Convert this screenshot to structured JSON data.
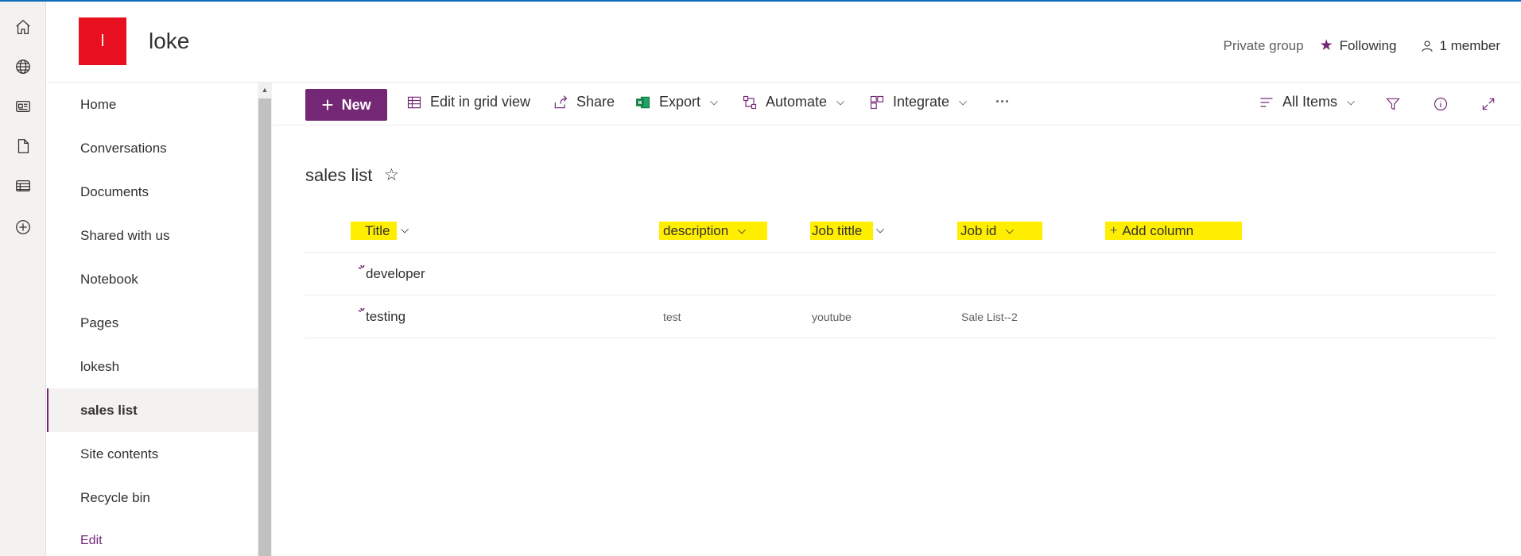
{
  "rail": {
    "items": [
      "home-icon",
      "globe-icon",
      "news-icon",
      "document-icon",
      "list-icon",
      "add-circle-icon"
    ]
  },
  "site": {
    "logo_letter": "l",
    "title": "loke",
    "privacy": "Private group",
    "following": "Following",
    "members": "1 member",
    "logo_color": "#e8101f",
    "accent_color": "#742774"
  },
  "nav": {
    "items": [
      {
        "label": "Home"
      },
      {
        "label": "Conversations"
      },
      {
        "label": "Documents"
      },
      {
        "label": "Shared with us"
      },
      {
        "label": "Notebook"
      },
      {
        "label": "Pages"
      },
      {
        "label": "lokesh"
      },
      {
        "label": "sales list"
      },
      {
        "label": "Site contents"
      },
      {
        "label": "Recycle bin"
      }
    ],
    "active": "sales list",
    "edit": "Edit"
  },
  "toolbar": {
    "new_label": "New",
    "grid_label": "Edit in grid view",
    "share_label": "Share",
    "export_label": "Export",
    "automate_label": "Automate",
    "integrate_label": "Integrate",
    "more_label": "···",
    "view_label": "All Items"
  },
  "list": {
    "title": "sales list",
    "columns": [
      "Title",
      "description",
      "Job tittle",
      "Job id",
      "Add column"
    ],
    "rows": [
      {
        "title": "developer",
        "description": "",
        "job_title": "",
        "job_id": ""
      },
      {
        "title": "testing",
        "description": "test",
        "job_title": "youtube",
        "job_id": "Sale List--2"
      }
    ]
  }
}
